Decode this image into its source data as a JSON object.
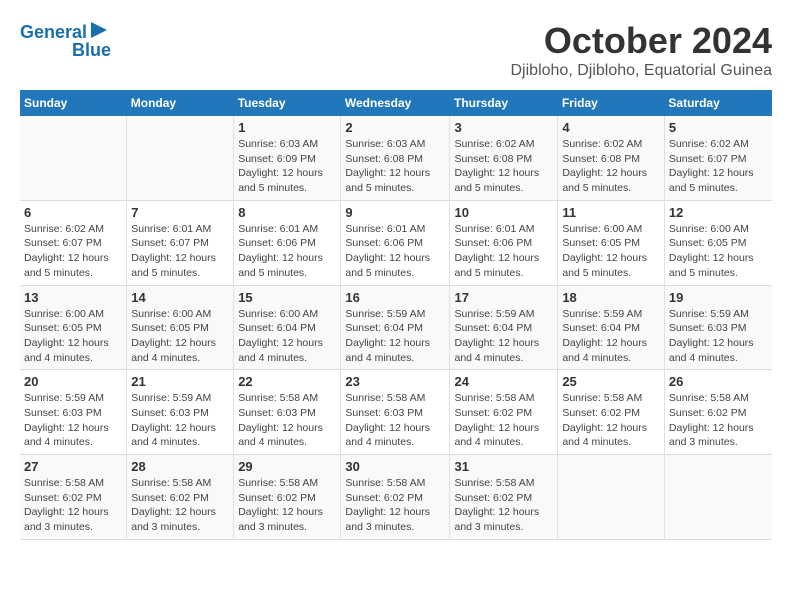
{
  "logo": {
    "line1": "General",
    "line2": "Blue"
  },
  "title": "October 2024",
  "subtitle": "Djibloho, Djibloho, Equatorial Guinea",
  "weekdays": [
    "Sunday",
    "Monday",
    "Tuesday",
    "Wednesday",
    "Thursday",
    "Friday",
    "Saturday"
  ],
  "weeks": [
    [
      {
        "day": "",
        "info": ""
      },
      {
        "day": "",
        "info": ""
      },
      {
        "day": "1",
        "info": "Sunrise: 6:03 AM\nSunset: 6:09 PM\nDaylight: 12 hours and 5 minutes."
      },
      {
        "day": "2",
        "info": "Sunrise: 6:03 AM\nSunset: 6:08 PM\nDaylight: 12 hours and 5 minutes."
      },
      {
        "day": "3",
        "info": "Sunrise: 6:02 AM\nSunset: 6:08 PM\nDaylight: 12 hours and 5 minutes."
      },
      {
        "day": "4",
        "info": "Sunrise: 6:02 AM\nSunset: 6:08 PM\nDaylight: 12 hours and 5 minutes."
      },
      {
        "day": "5",
        "info": "Sunrise: 6:02 AM\nSunset: 6:07 PM\nDaylight: 12 hours and 5 minutes."
      }
    ],
    [
      {
        "day": "6",
        "info": "Sunrise: 6:02 AM\nSunset: 6:07 PM\nDaylight: 12 hours and 5 minutes."
      },
      {
        "day": "7",
        "info": "Sunrise: 6:01 AM\nSunset: 6:07 PM\nDaylight: 12 hours and 5 minutes."
      },
      {
        "day": "8",
        "info": "Sunrise: 6:01 AM\nSunset: 6:06 PM\nDaylight: 12 hours and 5 minutes."
      },
      {
        "day": "9",
        "info": "Sunrise: 6:01 AM\nSunset: 6:06 PM\nDaylight: 12 hours and 5 minutes."
      },
      {
        "day": "10",
        "info": "Sunrise: 6:01 AM\nSunset: 6:06 PM\nDaylight: 12 hours and 5 minutes."
      },
      {
        "day": "11",
        "info": "Sunrise: 6:00 AM\nSunset: 6:05 PM\nDaylight: 12 hours and 5 minutes."
      },
      {
        "day": "12",
        "info": "Sunrise: 6:00 AM\nSunset: 6:05 PM\nDaylight: 12 hours and 5 minutes."
      }
    ],
    [
      {
        "day": "13",
        "info": "Sunrise: 6:00 AM\nSunset: 6:05 PM\nDaylight: 12 hours and 4 minutes."
      },
      {
        "day": "14",
        "info": "Sunrise: 6:00 AM\nSunset: 6:05 PM\nDaylight: 12 hours and 4 minutes."
      },
      {
        "day": "15",
        "info": "Sunrise: 6:00 AM\nSunset: 6:04 PM\nDaylight: 12 hours and 4 minutes."
      },
      {
        "day": "16",
        "info": "Sunrise: 5:59 AM\nSunset: 6:04 PM\nDaylight: 12 hours and 4 minutes."
      },
      {
        "day": "17",
        "info": "Sunrise: 5:59 AM\nSunset: 6:04 PM\nDaylight: 12 hours and 4 minutes."
      },
      {
        "day": "18",
        "info": "Sunrise: 5:59 AM\nSunset: 6:04 PM\nDaylight: 12 hours and 4 minutes."
      },
      {
        "day": "19",
        "info": "Sunrise: 5:59 AM\nSunset: 6:03 PM\nDaylight: 12 hours and 4 minutes."
      }
    ],
    [
      {
        "day": "20",
        "info": "Sunrise: 5:59 AM\nSunset: 6:03 PM\nDaylight: 12 hours and 4 minutes."
      },
      {
        "day": "21",
        "info": "Sunrise: 5:59 AM\nSunset: 6:03 PM\nDaylight: 12 hours and 4 minutes."
      },
      {
        "day": "22",
        "info": "Sunrise: 5:58 AM\nSunset: 6:03 PM\nDaylight: 12 hours and 4 minutes."
      },
      {
        "day": "23",
        "info": "Sunrise: 5:58 AM\nSunset: 6:03 PM\nDaylight: 12 hours and 4 minutes."
      },
      {
        "day": "24",
        "info": "Sunrise: 5:58 AM\nSunset: 6:02 PM\nDaylight: 12 hours and 4 minutes."
      },
      {
        "day": "25",
        "info": "Sunrise: 5:58 AM\nSunset: 6:02 PM\nDaylight: 12 hours and 4 minutes."
      },
      {
        "day": "26",
        "info": "Sunrise: 5:58 AM\nSunset: 6:02 PM\nDaylight: 12 hours and 3 minutes."
      }
    ],
    [
      {
        "day": "27",
        "info": "Sunrise: 5:58 AM\nSunset: 6:02 PM\nDaylight: 12 hours and 3 minutes."
      },
      {
        "day": "28",
        "info": "Sunrise: 5:58 AM\nSunset: 6:02 PM\nDaylight: 12 hours and 3 minutes."
      },
      {
        "day": "29",
        "info": "Sunrise: 5:58 AM\nSunset: 6:02 PM\nDaylight: 12 hours and 3 minutes."
      },
      {
        "day": "30",
        "info": "Sunrise: 5:58 AM\nSunset: 6:02 PM\nDaylight: 12 hours and 3 minutes."
      },
      {
        "day": "31",
        "info": "Sunrise: 5:58 AM\nSunset: 6:02 PM\nDaylight: 12 hours and 3 minutes."
      },
      {
        "day": "",
        "info": ""
      },
      {
        "day": "",
        "info": ""
      }
    ]
  ]
}
